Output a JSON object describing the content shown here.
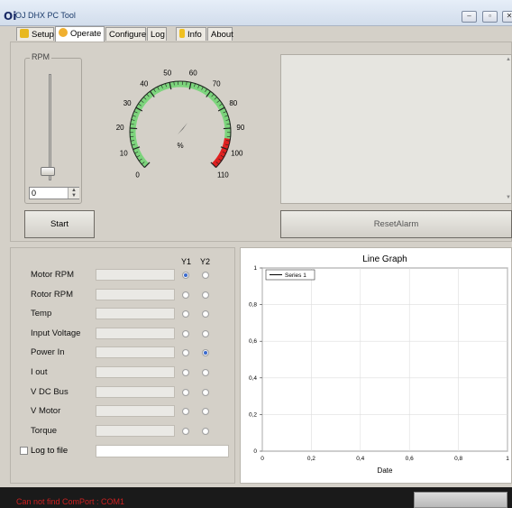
{
  "window": {
    "title": "OJ DHX PC Tool",
    "icon_text": "Oi"
  },
  "tabs": [
    {
      "label": "Setup",
      "icon": "setup-icon",
      "active": false
    },
    {
      "label": "Operate",
      "icon": "operate-icon",
      "active": true
    },
    {
      "label": "Configure",
      "active": false
    },
    {
      "label": "Log",
      "active": false
    },
    {
      "label": "Info",
      "icon": "info-icon",
      "active": false
    },
    {
      "label": "About",
      "active": false
    }
  ],
  "rpm_panel": {
    "label": "RPM",
    "value": "0",
    "slider_fraction": 0.0
  },
  "gauge": {
    "ticks": [
      "0",
      "10",
      "20",
      "30",
      "40",
      "50",
      "60",
      "70",
      "80",
      "90",
      "100",
      "110"
    ],
    "unit": "%",
    "value": 0,
    "min": 0,
    "max": 110,
    "green_range": [
      0,
      95
    ],
    "red_range": [
      95,
      110
    ],
    "colors": {
      "green": "#7cd47c",
      "red": "#e02020",
      "needle": "#555555"
    }
  },
  "buttons": {
    "start": "Start",
    "reset_alarm": "ResetAlarm"
  },
  "measurements": {
    "col_y1": "Y1",
    "col_y2": "Y2",
    "rows": [
      {
        "label": "Motor RPM",
        "value": "",
        "y1": true,
        "y2": false
      },
      {
        "label": "Rotor RPM",
        "value": "",
        "y1": false,
        "y2": false
      },
      {
        "label": "Temp",
        "value": "",
        "y1": false,
        "y2": false
      },
      {
        "label": "Input Voltage",
        "value": "",
        "y1": false,
        "y2": false
      },
      {
        "label": "Power In",
        "value": "",
        "y1": false,
        "y2": true
      },
      {
        "label": "I out",
        "value": "",
        "y1": false,
        "y2": false
      },
      {
        "label": "V DC Bus",
        "value": "",
        "y1": false,
        "y2": false
      },
      {
        "label": "V Motor",
        "value": "",
        "y1": false,
        "y2": false
      },
      {
        "label": "Torque",
        "value": "",
        "y1": false,
        "y2": false
      }
    ],
    "log_label": "Log to file",
    "log_checked": false,
    "log_path": ""
  },
  "chart_data": {
    "type": "line",
    "title": "Line Graph",
    "xlabel": "Date",
    "ylabel": "",
    "xlim": [
      0,
      1
    ],
    "ylim": [
      0,
      1
    ],
    "x_ticks": [
      "0",
      "0,2",
      "0,4",
      "0,6",
      "0,8",
      "1"
    ],
    "y_ticks": [
      "0",
      "0,2",
      "0,4",
      "0,6",
      "0,8",
      "1"
    ],
    "series": [
      {
        "name": "Series 1",
        "x": [],
        "values": []
      }
    ],
    "grid": true,
    "legend": "top-left"
  },
  "status": {
    "message": "Can not find ComPort : COM1"
  }
}
